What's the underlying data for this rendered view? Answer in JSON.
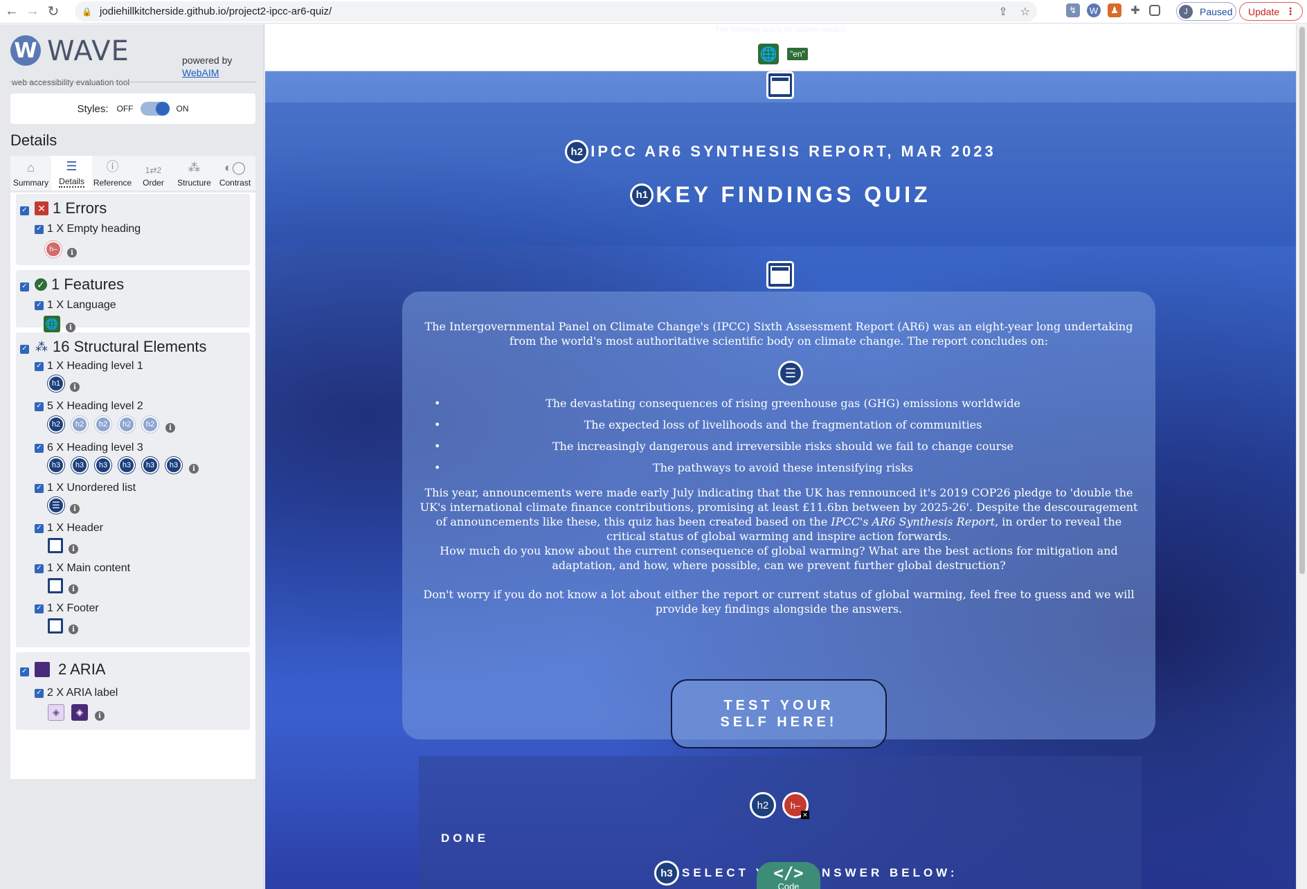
{
  "browser": {
    "url": "jodiehillkitcherside.github.io/project2-ipcc-ar6-quiz/",
    "profile_initial": "J",
    "paused_label": "Paused",
    "update_label": "Update"
  },
  "wave": {
    "title": "WAVE",
    "logo_letter": "W",
    "subtitle": "web accessibility evaluation tool",
    "powered_by": "powered by",
    "powered_link": "WebAIM",
    "styles_label": "Styles:",
    "styles_off": "OFF",
    "styles_on": "ON",
    "details_heading": "Details",
    "tabs": [
      {
        "label": "Summary",
        "icon": "home-icon"
      },
      {
        "label": "Details",
        "icon": "list-icon"
      },
      {
        "label": "Reference",
        "icon": "info-icon"
      },
      {
        "label": "Order",
        "icon": "order-icon"
      },
      {
        "label": "Structure",
        "icon": "structure-icon"
      },
      {
        "label": "Contrast",
        "icon": "contrast-icon"
      }
    ],
    "groups": {
      "errors": {
        "title": "1 Errors",
        "items": [
          {
            "label": "1 X Empty heading",
            "icons": [
              "h-"
            ]
          }
        ]
      },
      "features": {
        "title": "1 Features",
        "items": [
          {
            "label": "1 X Language",
            "icons": [
              "globe"
            ]
          }
        ]
      },
      "structural": {
        "title": "16 Structural Elements",
        "items": [
          {
            "label": "1 X Heading level 1",
            "icons": [
              "h1"
            ]
          },
          {
            "label": "5 X Heading level 2",
            "icons": [
              "h2",
              "h2",
              "h2",
              "h2",
              "h2"
            ]
          },
          {
            "label": "6 X Heading level 3",
            "icons": [
              "h3",
              "h3",
              "h3",
              "h3",
              "h3",
              "h3"
            ]
          },
          {
            "label": "1 X Unordered list",
            "icons": [
              "list"
            ]
          },
          {
            "label": "1 X Header",
            "icons": [
              "header"
            ]
          },
          {
            "label": "1 X Main content",
            "icons": [
              "main"
            ]
          },
          {
            "label": "1 X Footer",
            "icons": [
              "footer"
            ]
          }
        ]
      },
      "aria": {
        "title": "2 ARIA",
        "items": [
          {
            "label": "2 X ARIA label",
            "icons": [
              "tag",
              "tag"
            ]
          }
        ]
      }
    }
  },
  "page": {
    "top_note": "The following text is for screen readers",
    "lang_code": "\"en\"",
    "subtitle_badge": "h2",
    "subtitle": "IPCC AR6 SYNTHESIS REPORT, MAR 2023",
    "title_badge": "h1",
    "title": "KEY FINDINGS QUIZ",
    "intro": "The Intergovernmental Panel on Climate Change's (IPCC) Sixth Assessment Report (AR6) was an eight-year long undertaking from the world's most authoritative scientific body on climate change. The report concludes on:",
    "bullets": [
      "The devastating consequences of rising greenhouse gas (GHG) emissions worldwide",
      "The expected loss of livelihoods and the fragmentation of communities",
      "The increasingly dangerous and irreversible risks should we fail to change course",
      "The pathways to avoid these intensifying risks"
    ],
    "para_1_pre": "This year, announcements were made early July indicating that the UK has rennounced it's 2019 COP26 pledge to 'double the UK's international climate finance contributions, promising at least £11.6bn between by 2025-26'. Despite the descouragement of announcements like these, this quiz has been created based on the ",
    "para_1_em": "IPCC's AR6 Synthesis Report",
    "para_1_post": ", in order to reveal the critical status of global warming and inspire action forwards.",
    "para_2": "How much do you know about the current consequence of global warming? What are the best actions for mitigation and adaptation, and how, where possible, can we prevent further global destruction?",
    "para_3": "Don't worry if you do not know a lot about either the report or current status of global warming, feel free to guess and we will provide key findings alongside the answers.",
    "cta": "TEST YOUR SELF HERE!",
    "quiz_badge_h2": "h2",
    "quiz_badge_err": "h–",
    "done": "DONE",
    "select_badge": "h3",
    "select_answer": "SELECT YOUR ANSWER BELOW:",
    "code_glyph": "</>",
    "code_label": "Code"
  },
  "colors": {
    "wave_blue": "#1d3f7c",
    "error_red": "#c43a2f",
    "feature_green": "#2e6d36",
    "aria_purple": "#4a2a7a"
  }
}
